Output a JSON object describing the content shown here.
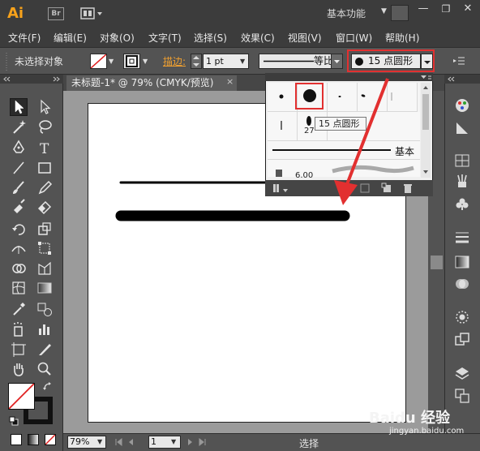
{
  "app": {
    "logo": "Ai",
    "bridge": "Br",
    "workspace": "基本功能"
  },
  "menu": [
    "文件(F)",
    "编辑(E)",
    "对象(O)",
    "文字(T)",
    "选择(S)",
    "效果(C)",
    "视图(V)",
    "窗口(W)",
    "帮助(H)"
  ],
  "control": {
    "selection_label": "未选择对象",
    "stroke_label": "描边:",
    "stroke_weight": "1 pt",
    "profile": "等比",
    "brush": "15 点圆形"
  },
  "document": {
    "tab_title": "未标题-1* @ 79% (CMYK/预览)",
    "tab_close": "×"
  },
  "brushes_panel": {
    "tooltip": "15 点圆形",
    "basic_label": "基本",
    "size_label_1": "27",
    "size_label_2": "6.00"
  },
  "status": {
    "zoom": "79%",
    "page": "1",
    "text": "选择"
  },
  "watermark": {
    "brand": "Baidu 经验",
    "url": "jingyan.baidu.com"
  },
  "colors": {
    "highlight": "#e23030",
    "accent": "#f7a21b",
    "stroke_label": "#f0a030"
  }
}
